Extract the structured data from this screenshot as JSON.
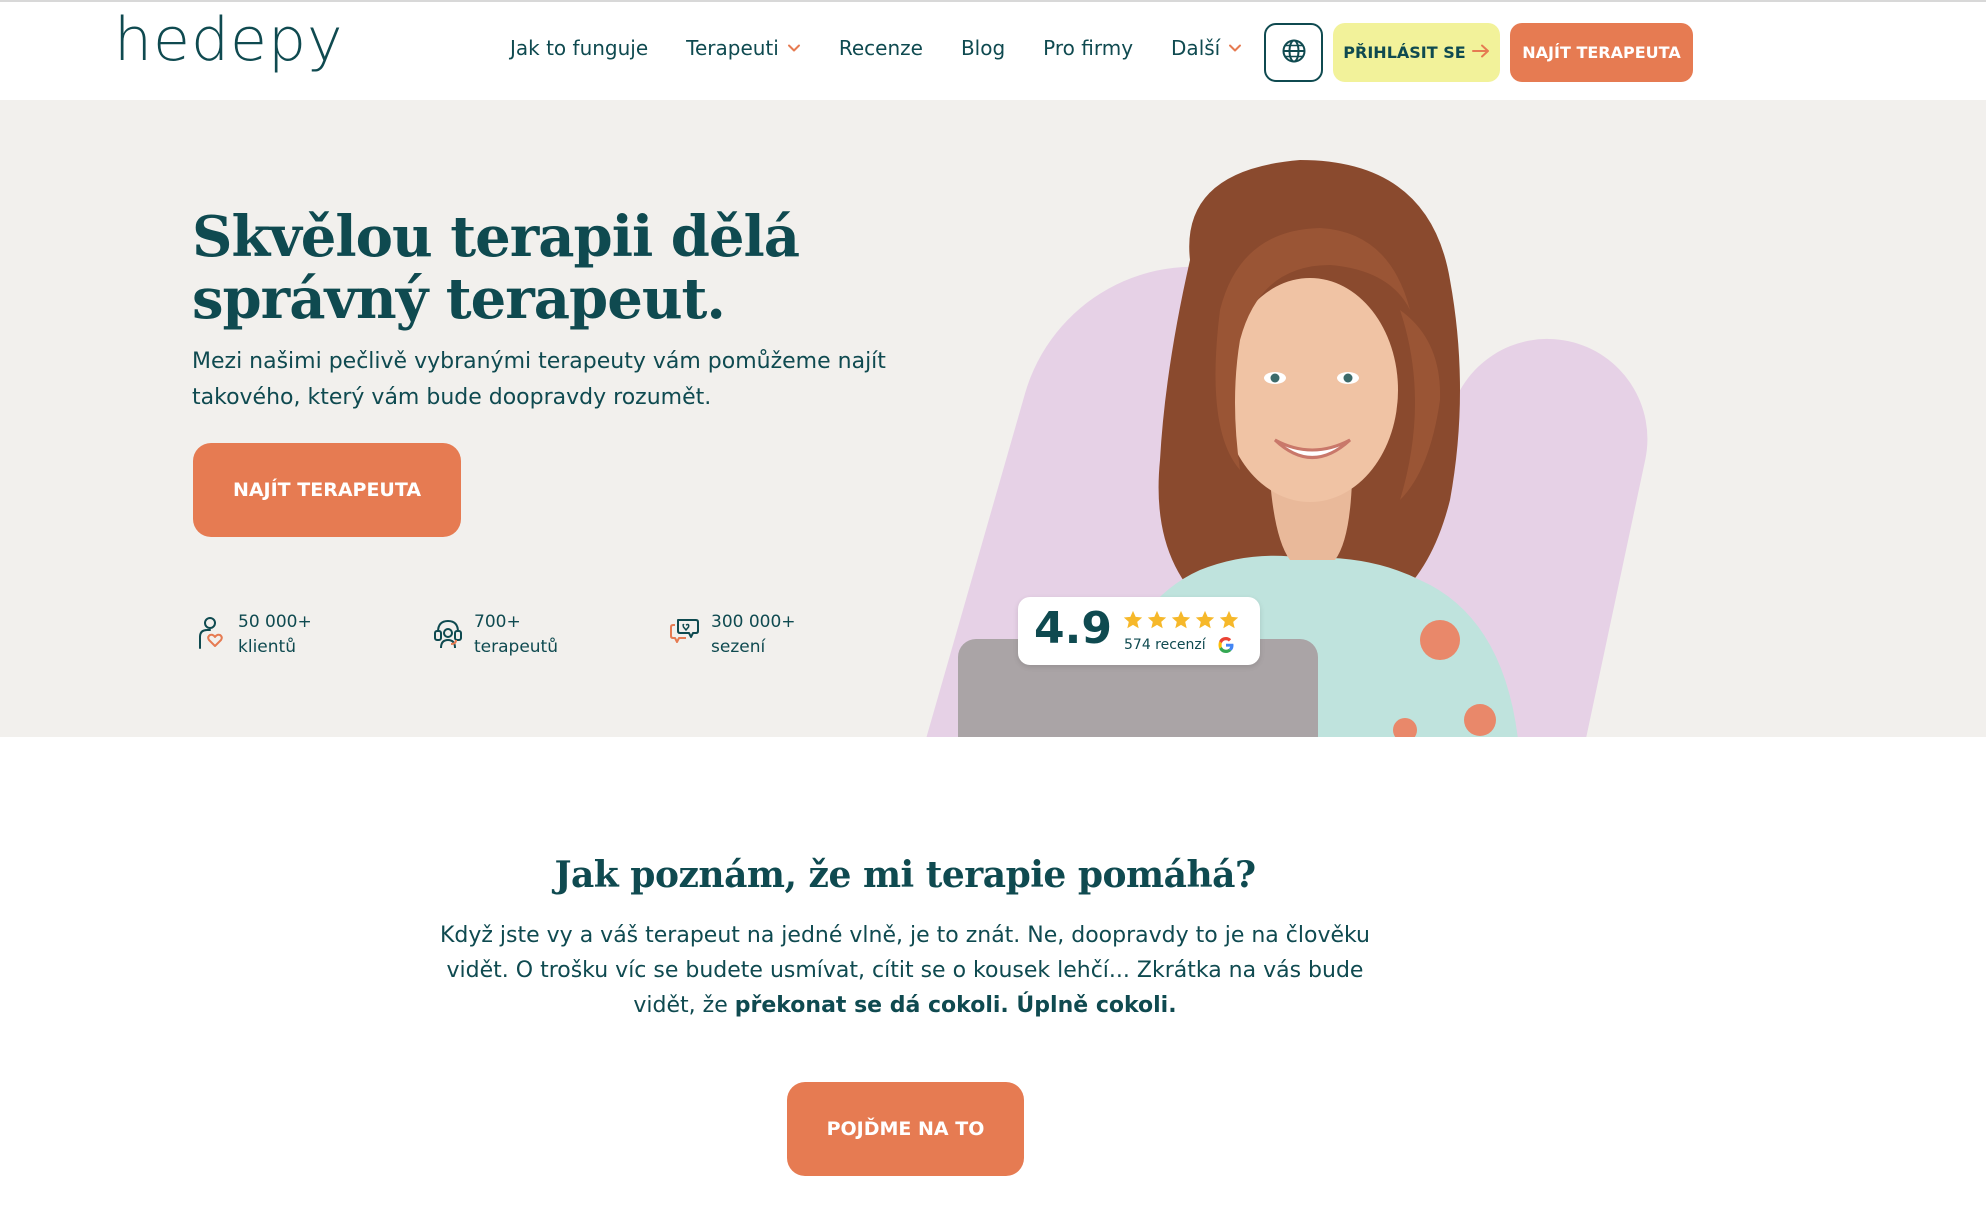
{
  "header": {
    "logo": "hedepy",
    "nav": [
      {
        "label": "Jak to funguje",
        "dropdown": false
      },
      {
        "label": "Terapeuti",
        "dropdown": true
      },
      {
        "label": "Recenze",
        "dropdown": false
      },
      {
        "label": "Blog",
        "dropdown": false
      },
      {
        "label": "Pro firmy",
        "dropdown": false
      },
      {
        "label": "Další",
        "dropdown": true
      }
    ],
    "globe_icon": "globe-icon",
    "login_label": "PŘIHLÁSIT SE",
    "find_label": "NAJÍT TERAPEUTA"
  },
  "hero": {
    "title_line1": "Skvělou terapii dělá",
    "title_line2": "správný terapeut.",
    "sub_line1": "Mezi našimi pečlivě vybranými terapeuty vám pomůžeme najít",
    "sub_line2": "takového, který vám bude doopravdy rozumět.",
    "cta_label": "NAJÍT TERAPEUTA",
    "stats": [
      {
        "icon": "client-heart-icon",
        "value": "50 000+",
        "label": "klientů"
      },
      {
        "icon": "therapist-headset-icon",
        "value": "700+",
        "label": "terapeutů"
      },
      {
        "icon": "chat-bubbles-icon",
        "value": "300 000+",
        "label": "sezení"
      }
    ],
    "rating": {
      "score": "4.9",
      "stars": 5,
      "count_label": "574 recenzí",
      "source_icon": "google-icon"
    }
  },
  "section": {
    "title": "Jak poznám, že mi terapie pomáhá?",
    "line1": "Když jste vy a váš terapeut na jedné vlně, je to znát. Ne, doopravdy to je na člověku",
    "line2": "vidět. O trošku víc se budete usmívat, cítit se o kousek lehčí... Zkrátka na vás bude",
    "line3_plain": "vidět, že ",
    "line3_bold": "překonat se dá cokoli. Úplně cokoli.",
    "cta_label": "POJĎME NA TO"
  },
  "colors": {
    "brand_teal": "#0f4a50",
    "accent_orange": "#e67b52",
    "login_yellow": "#f2f29a",
    "hero_bg": "#f2f0ed",
    "blob_lilac": "#e6d1e6",
    "star_gold": "#f6b82a"
  }
}
